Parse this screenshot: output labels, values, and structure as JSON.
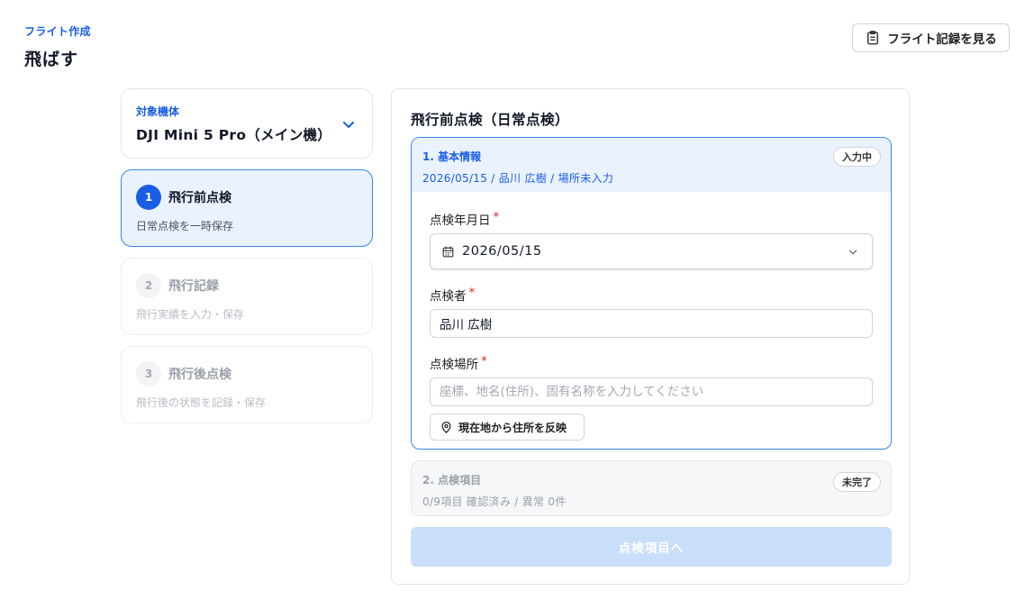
{
  "header": {
    "eyebrow": "フライト作成",
    "title": "飛ばす",
    "log_button_label": "フライト記録を見る"
  },
  "aircraft": {
    "label": "対象機体",
    "name": "DJI Mini 5 Pro（メイン機）"
  },
  "steps": [
    {
      "number": "1",
      "title": "飛行前点検",
      "subtitle": "日常点検を一時保存",
      "state": "active"
    },
    {
      "number": "2",
      "title": "飛行記録",
      "subtitle": "飛行実績を入力・保存",
      "state": "inactive"
    },
    {
      "number": "3",
      "title": "飛行後点検",
      "subtitle": "飛行後の状態を記録・保存",
      "state": "inactive"
    }
  ],
  "main": {
    "title": "飛行前点検（日常点検）",
    "basic_section": {
      "title": "1. 基本情報",
      "summary": "2026/05/15 / 品川 広樹 / 場所未入力",
      "badge": "入力中",
      "date_label": "点検年月日",
      "date_value": "2026/05/15",
      "inspector_label": "点検者",
      "inspector_value": "品川 広樹",
      "location_label": "点検場所",
      "location_placeholder": "座標、地名(住所)、固有名称を入力してください",
      "location_button": "現在地から住所を反映",
      "required_mark": "*"
    },
    "items_section": {
      "title": "2. 点検項目",
      "summary": "0/9項目 確認済み / 異常 0件",
      "badge": "未完了"
    },
    "next_button": "点検項目へ"
  },
  "colors": {
    "accent": "#1a5ee6",
    "active_bg": "#e9f2fe",
    "active_border": "#3a86e8",
    "required": "#e02424",
    "disabled_button": "#c9def9"
  }
}
